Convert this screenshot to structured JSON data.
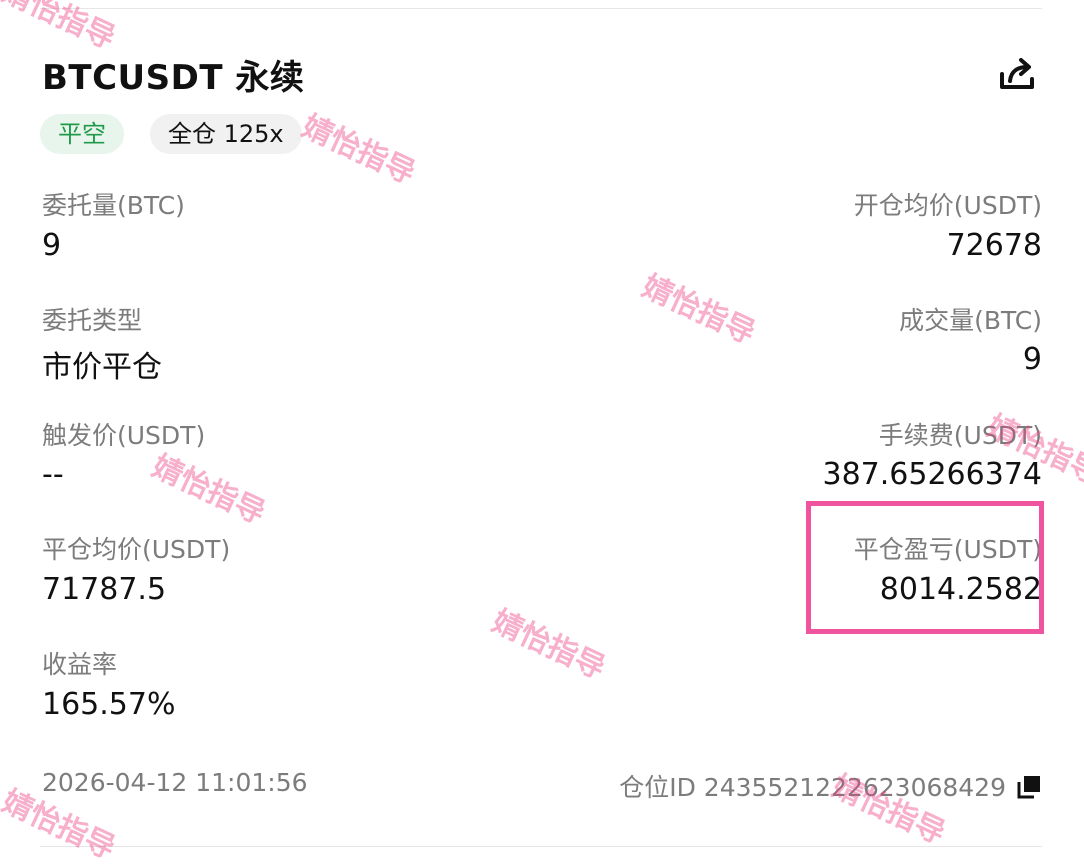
{
  "header": {
    "title": "BTCUSDT 永续",
    "share_icon": "share-icon"
  },
  "tags": {
    "side": "平空",
    "margin_mode": "全仓 125x"
  },
  "colors": {
    "side_tag_text": "#1f9a4a",
    "side_tag_bg": "#e8f5ec",
    "highlight_border": "#f0549f",
    "watermark": "#ec4082"
  },
  "fields": {
    "order_qty": {
      "label": "委托量(BTC)",
      "value": "9"
    },
    "open_avg_price": {
      "label": "开仓均价(USDT)",
      "value": "72678"
    },
    "order_type": {
      "label": "委托类型",
      "value": "市价平仓"
    },
    "filled_qty": {
      "label": "成交量(BTC)",
      "value": "9"
    },
    "trigger_price": {
      "label": "触发价(USDT)",
      "value": "--"
    },
    "fee": {
      "label": "手续费(USDT)",
      "value": "387.65266374"
    },
    "close_avg_price": {
      "label": "平仓均价(USDT)",
      "value": "71787.5"
    },
    "close_pnl": {
      "label": "平仓盈亏(USDT)",
      "value": "8014.2582"
    },
    "roe": {
      "label": "收益率",
      "value": "165.57%"
    }
  },
  "footer": {
    "timestamp": "2026-04-12 11:01:56",
    "position_id": "仓位ID 2435521222623068429",
    "copy_icon": "copy-icon"
  },
  "watermark_text": "婧怡指导"
}
